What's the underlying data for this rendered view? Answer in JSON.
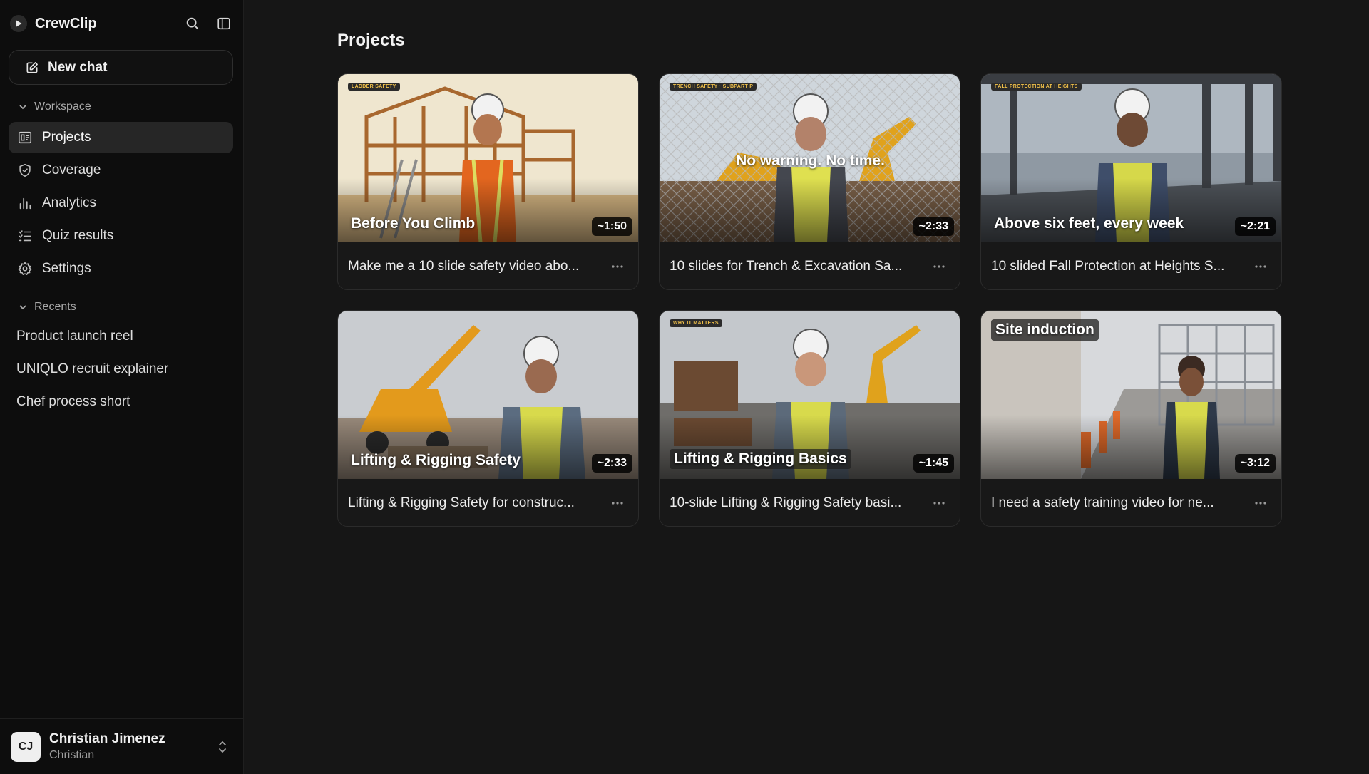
{
  "app": {
    "name": "CrewClip"
  },
  "sidebar": {
    "new_chat_label": "New chat",
    "workspace_heading": "Workspace",
    "nav": [
      {
        "label": "Projects",
        "icon": "projects-icon",
        "active": true
      },
      {
        "label": "Coverage",
        "icon": "shield-icon"
      },
      {
        "label": "Analytics",
        "icon": "bar-chart-icon"
      },
      {
        "label": "Quiz results",
        "icon": "checklist-icon"
      },
      {
        "label": "Settings",
        "icon": "gear-icon"
      }
    ],
    "recents_heading": "Recents",
    "recents": [
      {
        "label": "Product launch reel"
      },
      {
        "label": "UNIQLO recruit explainer"
      },
      {
        "label": "Chef process short"
      }
    ]
  },
  "user": {
    "initials": "CJ",
    "name": "Christian Jimenez",
    "subtitle": "Christian"
  },
  "main": {
    "title": "Projects",
    "projects": [
      {
        "thumb_title": "Before You Climb",
        "tag": "LADDER SAFETY",
        "duration": "~1:50",
        "label": "Make me a 10 slide safety video abo..."
      },
      {
        "thumb_title": "No warning. No time.",
        "tag": "TRENCH SAFETY · SUBPART P",
        "duration": "~2:33",
        "label": "10 slides for Trench & Excavation Sa..."
      },
      {
        "thumb_title": "Above six feet, every week",
        "tag": "FALL PROTECTION AT HEIGHTS",
        "duration": "~2:21",
        "label": "10 slided Fall Protection at Heights S..."
      },
      {
        "thumb_title": "Lifting & Rigging Safety",
        "tag": "",
        "duration": "~2:33",
        "label": "Lifting & Rigging Safety for construc..."
      },
      {
        "thumb_title": "Lifting & Rigging Basics",
        "tag": "WHY IT MATTERS",
        "duration": "~1:45",
        "label": "10-slide Lifting & Rigging Safety basi..."
      },
      {
        "thumb_title": "Site induction",
        "tag": "",
        "duration": "~3:12",
        "label": "I need a safety training video for ne..."
      }
    ]
  },
  "colors": {
    "background": "#161616",
    "sidebar": "#0d0d0d",
    "active_nav": "#262626",
    "tag_text": "#f0c04a"
  }
}
